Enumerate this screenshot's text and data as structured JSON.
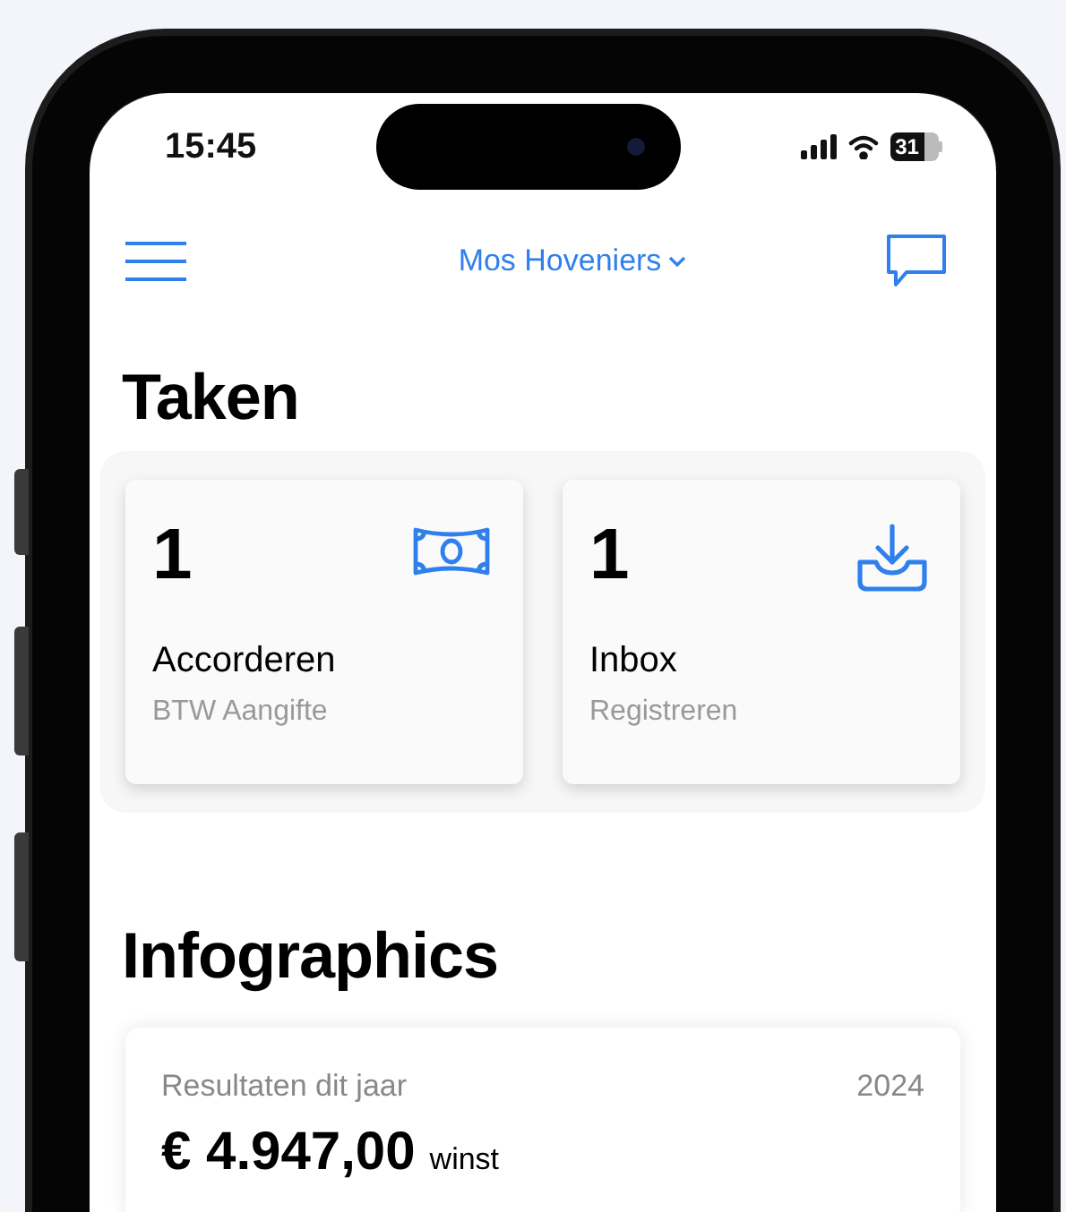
{
  "status_bar": {
    "time": "15:45",
    "battery": "31"
  },
  "header": {
    "company": "Mos Hoveniers"
  },
  "tasks": {
    "title": "Taken",
    "cards": [
      {
        "count": "1",
        "label": "Accorderen",
        "sublabel": "BTW Aangifte",
        "kind": "money"
      },
      {
        "count": "1",
        "label": "Inbox",
        "sublabel": "Registreren",
        "kind": "download"
      }
    ]
  },
  "infographics": {
    "title": "Infographics",
    "card": {
      "title": "Resultaten dit jaar",
      "year": "2024",
      "amount": "€ 4.947,00",
      "amount_label": "winst"
    }
  }
}
